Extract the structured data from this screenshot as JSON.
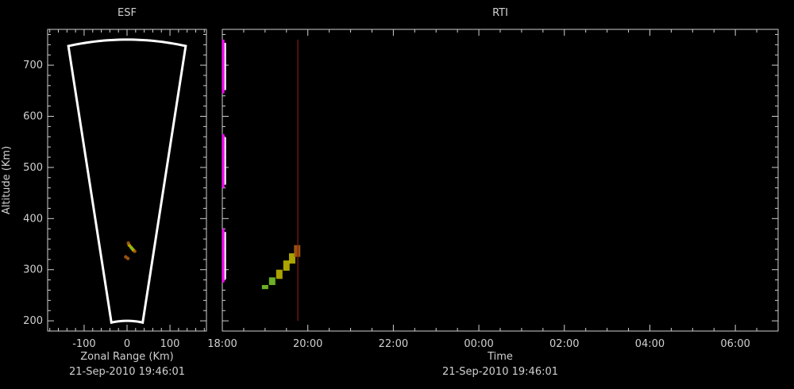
{
  "colors": {
    "background": "#000000",
    "axis": "#d0d0d0",
    "fan": "#ffffff",
    "marker": "#8b1a1a",
    "echo_green": "#7fcf2a",
    "echo_yellow": "#c8c000",
    "echo_orange": "#b06010",
    "echo_magenta": "#ff00ff"
  },
  "chart_data": [
    {
      "type": "heatmap",
      "panel": "esf",
      "title": "ESF",
      "xlabel": "Zonal Range (Km)",
      "ylabel": "Altitude (Km)",
      "timestamp": "21-Sep-2010 19:46:01",
      "xlim": [
        -185,
        185
      ],
      "ylim": [
        180,
        770
      ],
      "x_ticks": [
        -100,
        0,
        100
      ],
      "x_tick_labels": [
        "-100",
        "0",
        "100"
      ],
      "y_ticks": [
        200,
        300,
        400,
        500,
        600,
        700
      ],
      "y_tick_labels": [
        "200",
        "300",
        "400",
        "500",
        "600",
        "700"
      ],
      "fan": {
        "half_angle_deg": 10.5,
        "inner_range": 200,
        "outer_range": 750
      },
      "echo_points": [
        {
          "x": 5,
          "y": 348,
          "c": "echo_yellow"
        },
        {
          "x": 9,
          "y": 344,
          "c": "echo_yellow"
        },
        {
          "x": 12,
          "y": 341,
          "c": "echo_green"
        },
        {
          "x": 15,
          "y": 338,
          "c": "echo_yellow"
        },
        {
          "x": 18,
          "y": 336,
          "c": "echo_orange"
        },
        {
          "x": 3,
          "y": 352,
          "c": "echo_orange"
        },
        {
          "x": -3,
          "y": 325,
          "c": "echo_orange"
        },
        {
          "x": 2,
          "y": 322,
          "c": "echo_orange"
        }
      ]
    },
    {
      "type": "heatmap",
      "panel": "rti",
      "title": "RTI",
      "xlabel": "Time",
      "timestamp": "21-Sep-2010 19:46:01",
      "xlim": [
        "18:00",
        "07:00"
      ],
      "ylim": [
        180,
        770
      ],
      "x_ticks": [
        "18:00",
        "20:00",
        "22:00",
        "00:00",
        "02:00",
        "04:00",
        "06:00"
      ],
      "cursor_time": "19:46",
      "cursor_range": [
        200,
        750
      ],
      "strips": [
        {
          "t": "18:03",
          "y0": 645,
          "y1": 750
        },
        {
          "t": "18:03",
          "y0": 460,
          "y1": 565
        },
        {
          "t": "18:03",
          "y0": 275,
          "y1": 380
        }
      ],
      "echo_band": [
        {
          "t": "19:00",
          "y0": 262,
          "y1": 270,
          "c": "echo_green"
        },
        {
          "t": "19:10",
          "y0": 270,
          "y1": 285,
          "c": "echo_green"
        },
        {
          "t": "19:20",
          "y0": 282,
          "y1": 300,
          "c": "echo_yellow"
        },
        {
          "t": "19:30",
          "y0": 298,
          "y1": 318,
          "c": "echo_yellow"
        },
        {
          "t": "19:38",
          "y0": 312,
          "y1": 332,
          "c": "echo_yellow"
        },
        {
          "t": "19:45",
          "y0": 325,
          "y1": 348,
          "c": "echo_orange"
        }
      ]
    }
  ]
}
